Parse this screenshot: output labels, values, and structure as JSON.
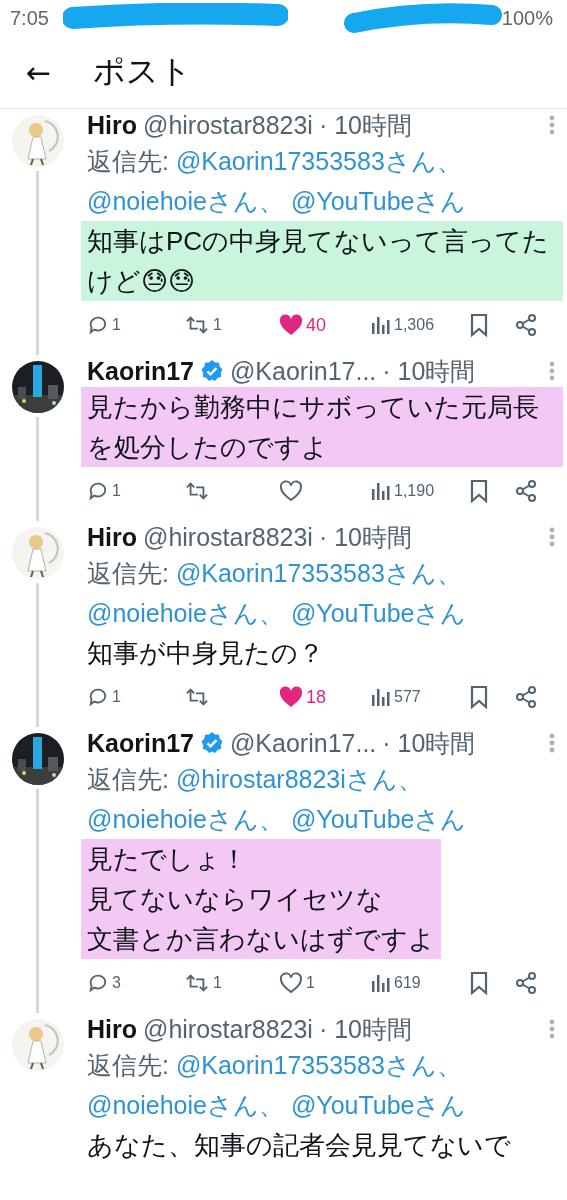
{
  "status_bar": {
    "time": "7:05",
    "battery": "100%"
  },
  "app_bar": {
    "back": "←",
    "title": "ポスト"
  },
  "posts": [
    {
      "name": "Hiro",
      "verified": false,
      "avatar": {
        "kind": "figure"
      },
      "handle": "@hirostar8823i",
      "time": "· 10時間",
      "reply_label": "返信先:",
      "mentions": [
        "@Kaorin17353583さん、",
        "@noiehoieさん、",
        "@YouTubeさん"
      ],
      "text": "知事はPCの中身見てないって言ってたけど😓😓",
      "color": "#c8f5dc",
      "stats": {
        "replies": "1",
        "reposts": "1",
        "likes": "40",
        "liked": true,
        "views": "1,306"
      }
    },
    {
      "name": "Kaorin17",
      "verified": true,
      "handle": "@Kaorin17...",
      "time": "· 10時間",
      "text": "見たから勤務中にサボっていた元局長を処分したのですよ",
      "color": "#f3c8f5",
      "stats": {
        "replies": "1",
        "liked": false,
        "views": "1,190"
      }
    },
    {
      "name": "Hiro",
      "verified": false,
      "avatar": {
        "kind": "figure"
      },
      "handle": "@hirostar8823i",
      "time": "· 10時間",
      "reply_label": "返信先:",
      "mentions": [
        "@Kaorin17353583さん、",
        "@noiehoieさん、",
        "@YouTubeさん"
      ],
      "text": "知事が中身見たの？",
      "stats": {
        "replies": "1",
        "likes": "18",
        "liked": true,
        "views": "577"
      }
    },
    {
      "name": "Kaorin17",
      "verified": true,
      "handle": "@Kaorin17...",
      "time": "· 10時間",
      "reply_label": "返信先:",
      "mentions": [
        "@hirostar8823iさん、",
        "@noiehoieさん、",
        "@YouTubeさん"
      ],
      "lines": [
        "見たでしょ！",
        "見てないならワイセツな",
        "文書とか言わないはずですよ"
      ],
      "color": "#f3c8f5",
      "stats": {
        "replies": "3",
        "reposts": "1",
        "likes": "1",
        "liked": false,
        "views": "619"
      }
    },
    {
      "name": "Hiro",
      "verified": false,
      "avatar": {
        "kind": "figure"
      },
      "handle": "@hirostar8823i",
      "time": "· 10時間",
      "reply_label": "返信先:",
      "mentions": [
        "@Kaorin17353583さん、",
        "@noiehoieさん、",
        "@YouTubeさん"
      ],
      "text": "あなた、知事の記者会見見てないで"
    }
  ]
}
